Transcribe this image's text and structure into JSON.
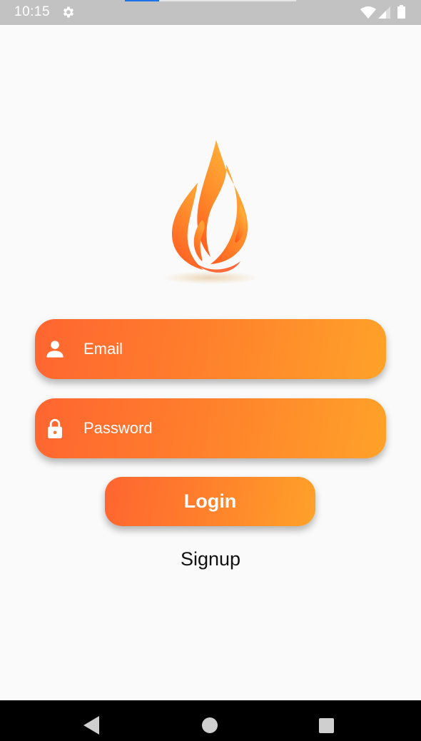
{
  "status_bar": {
    "time": "10:15",
    "icons": [
      "gear-icon",
      "wifi-icon",
      "signal-icon",
      "battery-icon"
    ],
    "loading_progress": 0.2,
    "background_color": "#c2c2c2"
  },
  "logo": {
    "icon": "flame-icon",
    "colors": [
      "#ff5a1f",
      "#ff8a2a",
      "#ffb33a"
    ]
  },
  "form": {
    "email": {
      "icon": "person-icon",
      "placeholder": "Email",
      "value": ""
    },
    "password": {
      "icon": "lock-icon",
      "placeholder": "Password",
      "value": ""
    },
    "login_label": "Login",
    "signup_label": "Signup"
  },
  "nav_bar": {
    "icons": [
      "back-icon",
      "home-icon",
      "recents-icon"
    ]
  },
  "colors": {
    "accent_start": "#ff6530",
    "accent_end": "#ffa229",
    "background": "#fafafa",
    "text": "#111111"
  }
}
